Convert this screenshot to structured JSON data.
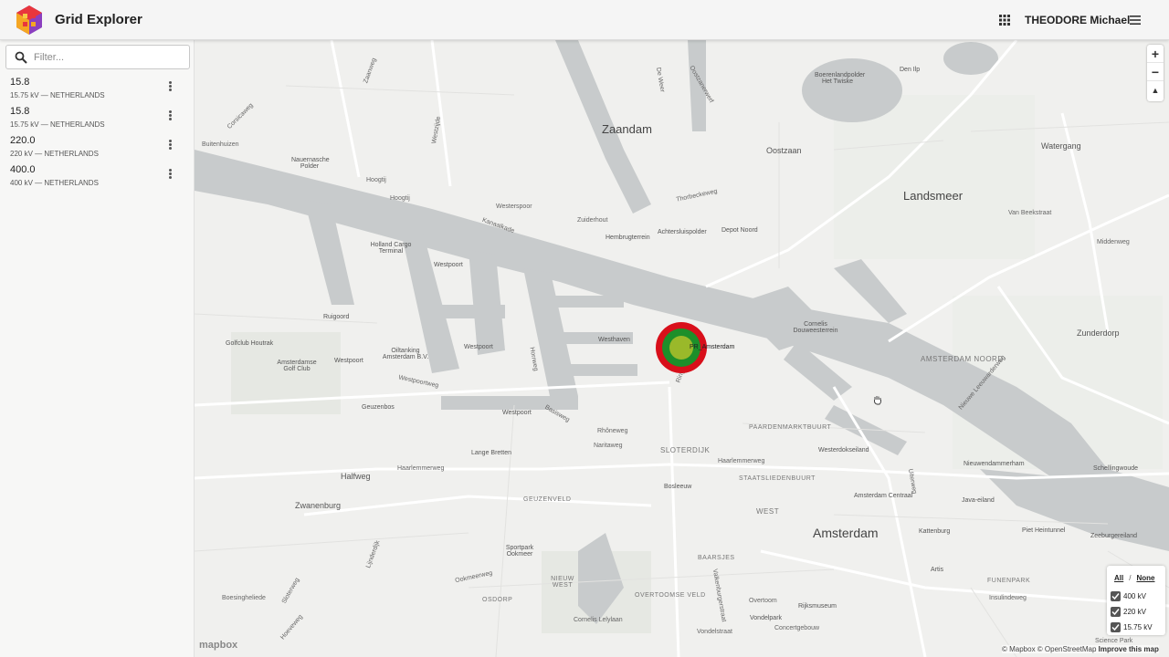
{
  "app": {
    "title": "Grid Explorer",
    "user_name": "THEODORE Michael",
    "logo_colors": [
      "#e8363d",
      "#f5a623",
      "#8b3fbf"
    ]
  },
  "sidebar": {
    "filter_placeholder": "Filter...",
    "filter_value": "",
    "items": [
      {
        "title": "15.8",
        "subtitle": "15.75 kV — NETHERLANDS"
      },
      {
        "title": "15.8",
        "subtitle": "15.75 kV — NETHERLANDS"
      },
      {
        "title": "220.0",
        "subtitle": "220 kV — NETHERLANDS"
      },
      {
        "title": "400.0",
        "subtitle": "400 kV — NETHERLANDS"
      }
    ]
  },
  "map": {
    "places": {
      "zaandam": "Zaandam",
      "landsmeer": "Landsmeer",
      "amsterdam": "Amsterdam",
      "oostzaan": "Oostzaan",
      "watergang": "Watergang",
      "zunderdorp": "Zunderdorp",
      "amsterdam_noord": "AMSTERDAM NOORD",
      "halfweg": "Halfweg",
      "zwanenburg": "Zwanenburg",
      "sloterdijk": "SLOTERDIJK",
      "westpoort1": "Westpoort",
      "westpoort2": "Westpoort",
      "westpoort3": "Westpoort",
      "westpoort4": "Westpoort",
      "holland_cargo": "Holland Cargo Terminal",
      "oiltanking": "Oiltanking Amsterdam B.V.",
      "amsterdamse_golf": "Amsterdamse Golf Club",
      "golfclub_houtrak": "Golfclub Houtrak",
      "ruigoord": "Ruigoord",
      "hemsbrugterrein": "Hembrugterrein",
      "achtersluispolder": "Achtersluispolder",
      "depot_noord": "Depot Noord",
      "westhaven": "Westhaven",
      "cornelis_douwes": "Cornelis Douweesterrein",
      "staatslieden": "STAATSLIEDENBUURT",
      "paardenmarkt": "PAARDENMARKTBUURT",
      "geuzenveld": "GEUZENVELD",
      "funenpark": "FUNENPARK",
      "westerdok": "Westerdokseiland",
      "amsterdam_centraal": "Amsterdam Centraal",
      "kattenburg": "Kattenburg",
      "java_eiland": "Java-eiland",
      "schellingwoude": "Schellingwoude",
      "nieuwendammerham": "Nieuwendammerham",
      "zeeburgereiland": "Zeeburgereiland",
      "piet_heinunnel": "Piet Heintunnel",
      "osdorp": "OSDORP",
      "bos_lommer": "Bosleeuw",
      "baarsjes": "BAARSJES",
      "overtoomse_veld": "OVERTOOMSE VELD",
      "rijksmuseum": "Rijksmuseum",
      "vondelpark": "Vondelpark",
      "oud_west": "WEST",
      "sportpark_ookmeer": "Sportpark Ookmeer",
      "nieuw_west": "NIEUW WEST",
      "artis": "Artis",
      "insulindeweg": "Insulindeweg",
      "science_park": "Science Park",
      "middenweg": "Middenweg",
      "van_beekstraat": "Van Beekstraat",
      "nieuwe_leeuwarder": "Nieuwe Leeuwarderweg",
      "guzenbos": "Geuzenbos",
      "lange_bretten": "Lange Bretten",
      "rhoneweg": "Rhôneweg",
      "naritaweg": "Naritaweg",
      "haarlemmerweg": "Haarlemmerweg",
      "haarlemmerweg2": "Haarlemmerweg",
      "westpoortweg": "Westpoortweg",
      "kanaaldijk": "Kanaalkade",
      "thorbeckeweg": "Thorbeckeweg",
      "westerspoor": "Westerspoor",
      "zuiderhout": "Zuiderhout",
      "hoogtij": "Hoogtij",
      "hoogtij2": "Hoogtij",
      "nauernasche_polder": "Nauernasche Polder",
      "buitenhuizen": "Buitenhuizen",
      "dorpsbrug": "Corsicaweg",
      "den_ilp": "Den Ilp",
      "broekermeer": "Boerenlandpolder Het Twiske",
      "dewijdewig": "De Weer",
      "oostzanerwerf": "Oostzanerwerf",
      "westzijde": "Westzijde",
      "zaandijk": "Zaanweg",
      "overtoom": "Overtoom",
      "concertgebouw": "Concertgebouw",
      "cornelis_lelylaan": "Cornelis Lelylaan",
      "boesingheliede": "Boesingheliede",
      "ookmeerweg": "Ookmeerweg",
      "sloterweg": "Sloterweg",
      "basisweg": "Basisweg",
      "horweg": "Horrweg",
      "duivendrecht": "Uiterweg",
      "valkenburgerstraat": "Valkenburgerstraat",
      "ringdijk": "Ring",
      "hoeveweg": "Hoeveweg",
      "lijnderdijk": "Lijnderdijk",
      "raadhuisstraat": "Vondelstraat"
    },
    "marker": {
      "label": "PR_Amsterdam",
      "colors": {
        "outer": "#d80f1a",
        "mid": "#1d8f2a",
        "inner": "#9ab92a"
      }
    },
    "zoom": {
      "in": "+",
      "out": "−",
      "compass": "▲"
    },
    "legend": {
      "all": "All",
      "separator": "/",
      "none": "None",
      "layers": [
        {
          "label": "400 kV",
          "checked": true
        },
        {
          "label": "220 kV",
          "checked": true
        },
        {
          "label": "15.75 kV",
          "checked": true
        }
      ]
    },
    "attribution": {
      "text": "© Mapbox © OpenStreetMap",
      "improve": "Improve this map",
      "logo": "mapbox"
    },
    "colors": {
      "water": "#c8cbcc",
      "land": "#f0f0ee",
      "road": "#ffffff",
      "park": "#e7e9e4"
    }
  }
}
